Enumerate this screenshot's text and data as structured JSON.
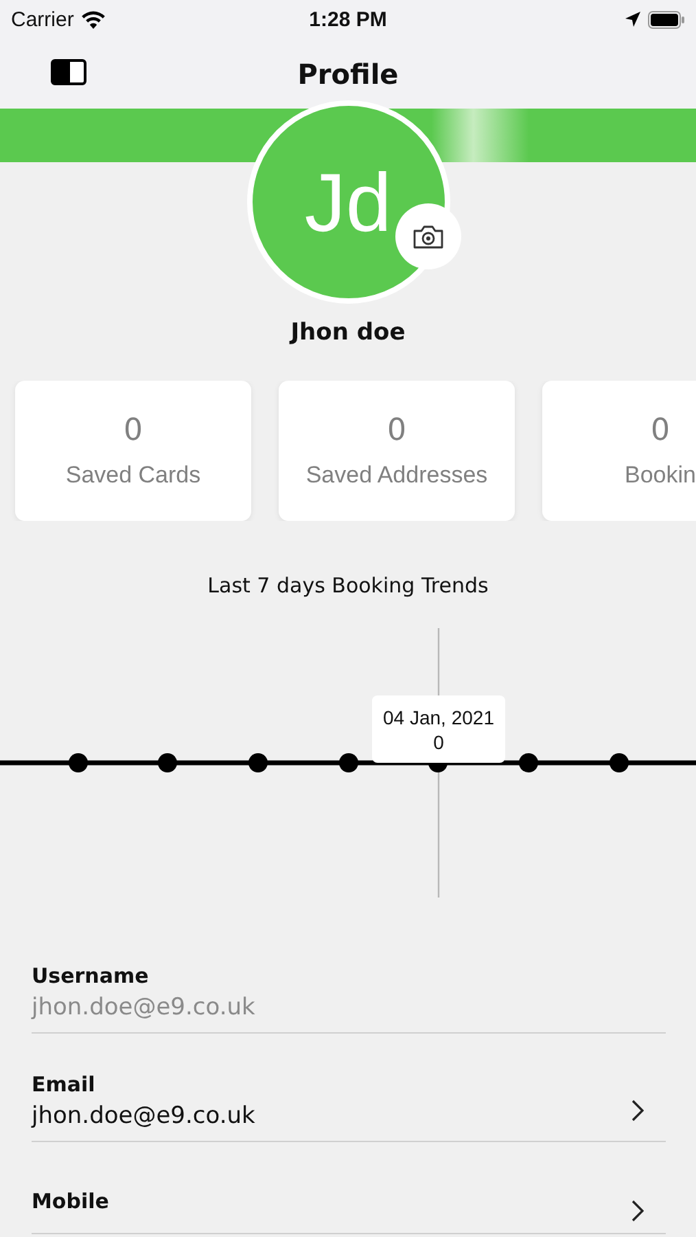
{
  "status_bar": {
    "carrier": "Carrier",
    "time": "1:28 PM"
  },
  "nav_bar": {
    "title": "Profile"
  },
  "profile": {
    "initials": "Jd",
    "name": "Jhon doe"
  },
  "stats": [
    {
      "count": "0",
      "label": "Saved Cards"
    },
    {
      "count": "0",
      "label": "Saved Addresses"
    },
    {
      "count": "0",
      "label": "Bookin"
    }
  ],
  "trend": {
    "title": "Last 7 days Booking Trends",
    "tooltip": {
      "date": "04 Jan, 2021",
      "value": "0"
    }
  },
  "fields": [
    {
      "label": "Username",
      "value": "jhon.doe@e9.co.uk",
      "disabled": true
    },
    {
      "label": "Email",
      "value": "jhon.doe@e9.co.uk",
      "disabled": false
    },
    {
      "label": "Mobile",
      "disabled": false
    }
  ]
}
